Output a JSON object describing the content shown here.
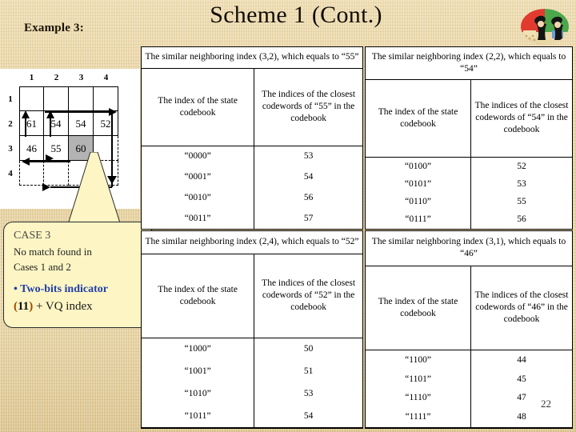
{
  "slide": {
    "title": "Scheme 1 (Cont.)",
    "example_label": "Example 3:",
    "page_number": "22"
  },
  "clipart": {
    "name": "people-clipart"
  },
  "grid": {
    "column_headers": [
      "1",
      "2",
      "3",
      "4"
    ],
    "row_headers": [
      "1",
      "2",
      "3",
      "4"
    ],
    "cells": [
      [
        "",
        "",
        "",
        ""
      ],
      [
        "61",
        "54",
        "54",
        "52"
      ],
      [
        "46",
        "55",
        "60",
        ""
      ],
      [
        "",
        "",
        "",
        ""
      ]
    ],
    "highlighted_cell": "60",
    "circle_marker": "red-circle-around-60"
  },
  "callout": {
    "case_title": "CASE 3",
    "line1": "No match found in",
    "line2": "Cases 1 and 2",
    "bullet": "Two-bits indicator",
    "bullet_glyph": "•",
    "last_prefix": "(",
    "last_bits": "11",
    "last_suffix": ")",
    "last_rest": " + VQ index"
  },
  "tables": [
    {
      "id": "table-55",
      "header": "The similar neighboring index (3,2), which equals to “55”",
      "columns": [
        "The index of the state codebook",
        "The indices of the closest codewords of “55” in the codebook"
      ],
      "rows": [
        [
          "“0000”",
          "53"
        ],
        [
          "“0001”",
          "54"
        ],
        [
          "“0010”",
          "56"
        ],
        [
          "“0011”",
          "57"
        ]
      ]
    },
    {
      "id": "table-54",
      "header": "The similar neighboring index (2,2), which equals to “54”",
      "columns": [
        "The index of the state codebook",
        "The indices of the closest codewords of “54” in the codebook"
      ],
      "rows": [
        [
          "“0100”",
          "52"
        ],
        [
          "“0101”",
          "53"
        ],
        [
          "“0110”",
          "55"
        ],
        [
          "“0111”",
          "56"
        ]
      ]
    },
    {
      "id": "table-52",
      "header": "The similar neighboring index (2,4), which equals to “52”",
      "columns": [
        "The index of the state codebook",
        "The indices of the closest codewords of “52” in the codebook"
      ],
      "rows": [
        [
          "“1000”",
          "50"
        ],
        [
          "“1001”",
          "51"
        ],
        [
          "“1010”",
          "53"
        ],
        [
          "“1011”",
          "54"
        ]
      ]
    },
    {
      "id": "table-46",
      "header": "The similar neighboring index (3,1), which equals to “46”",
      "columns": [
        "The index of the state codebook",
        "The indices of the closest codewords of “46” in the codebook"
      ],
      "rows": [
        [
          "“1100”",
          "44"
        ],
        [
          "“1101”",
          "45"
        ],
        [
          "“1110”",
          "47"
        ],
        [
          "“1111”",
          "48"
        ]
      ]
    }
  ],
  "colors": {
    "background": "#e6d3a5",
    "callout_fill": "#fdf5c4",
    "circle": "#cc1c1c",
    "shaded_cell": "#b3b3b3",
    "bullet_blue": "#1f3fa8"
  }
}
